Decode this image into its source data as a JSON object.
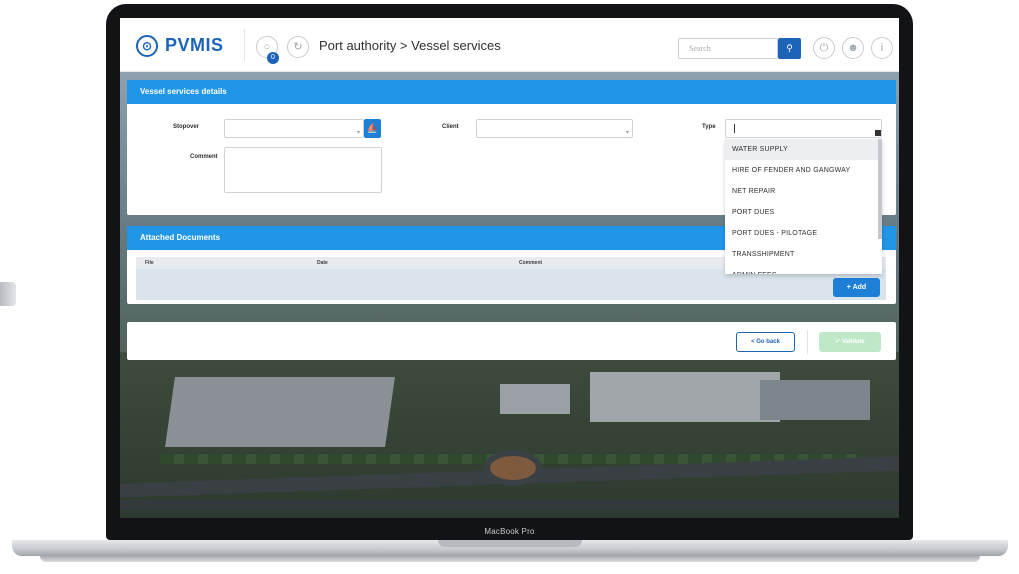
{
  "app": {
    "logo_glyph": "⊙",
    "logo_text": "PVMIS",
    "breadcrumb": "Port authority > Vessel services",
    "notification_count": "0"
  },
  "header": {
    "search_placeholder": "Search",
    "search_icon": "search-icon",
    "buttons": [
      "power-icon",
      "user-icon",
      "info-icon"
    ]
  },
  "vessel_services": {
    "title": "Vessel services details",
    "stopover_label": "Stopover",
    "stopover_value": "",
    "client_label": "Client",
    "client_value": "",
    "type_label": "Type",
    "type_value": "",
    "comment_label": "Comment",
    "comment_value": "",
    "type_options": [
      "WATER SUPPLY",
      "HIRE OF FENDER AND GANGWAY",
      "NET REPAIR",
      "PORT DUES",
      "PORT DUES - PILOTAGE",
      "TRANSSHIPMENT",
      "ADMIN FEES"
    ]
  },
  "attached_documents": {
    "title": "Attached Documents",
    "columns": [
      "File",
      "Date",
      "Comment"
    ],
    "add_label": "+ Add"
  },
  "footer_actions": {
    "go_back_label": "< Go back",
    "validate_label": "✓ Validate"
  },
  "device": {
    "brand": "MacBook Pro"
  },
  "colors": {
    "primary": "#1d63b8",
    "header_blue": "#2196e6",
    "validate_disabled": "#bfe8c9"
  }
}
